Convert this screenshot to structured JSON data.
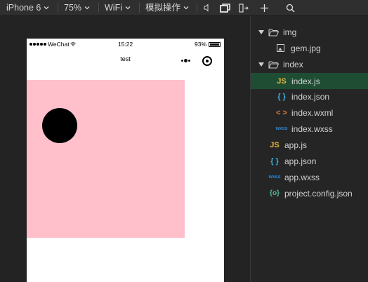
{
  "toolbar": {
    "device": "iPhone 6",
    "zoom": "75%",
    "network": "WiFi",
    "simulate": "模拟操作",
    "icons": [
      "speaker-icon",
      "window-icon",
      "exit-icon",
      "add-icon",
      "search-icon"
    ]
  },
  "phone": {
    "status": {
      "carrier": "WeChat",
      "time": "15:22",
      "battery": "93%"
    },
    "nav_title": "test",
    "canvas": {
      "box_color": "#ffc0cb",
      "ball_color": "#000000"
    }
  },
  "file_tree": {
    "img_folder": "img",
    "img_file": "gem.jpg",
    "index_folder": "index",
    "index_js": "index.js",
    "index_json": "index.json",
    "index_wxml": "index.wxml",
    "index_wxss": "index.wxss",
    "app_js": "app.js",
    "app_json": "app.json",
    "app_wxss": "app.wxss",
    "project_config": "project.config.json",
    "active_file": "index.js",
    "icon_labels": {
      "js": "JS",
      "json": "{ }",
      "wxml": "< >",
      "wxss": "wxss",
      "config": "{o}"
    }
  },
  "colors": {
    "active_row": "#1e4d33",
    "js": "#e5b73b",
    "json": "#3db4e8",
    "wxml": "#e07b39",
    "wxss": "#2b88d8",
    "config": "#4fc08d"
  }
}
